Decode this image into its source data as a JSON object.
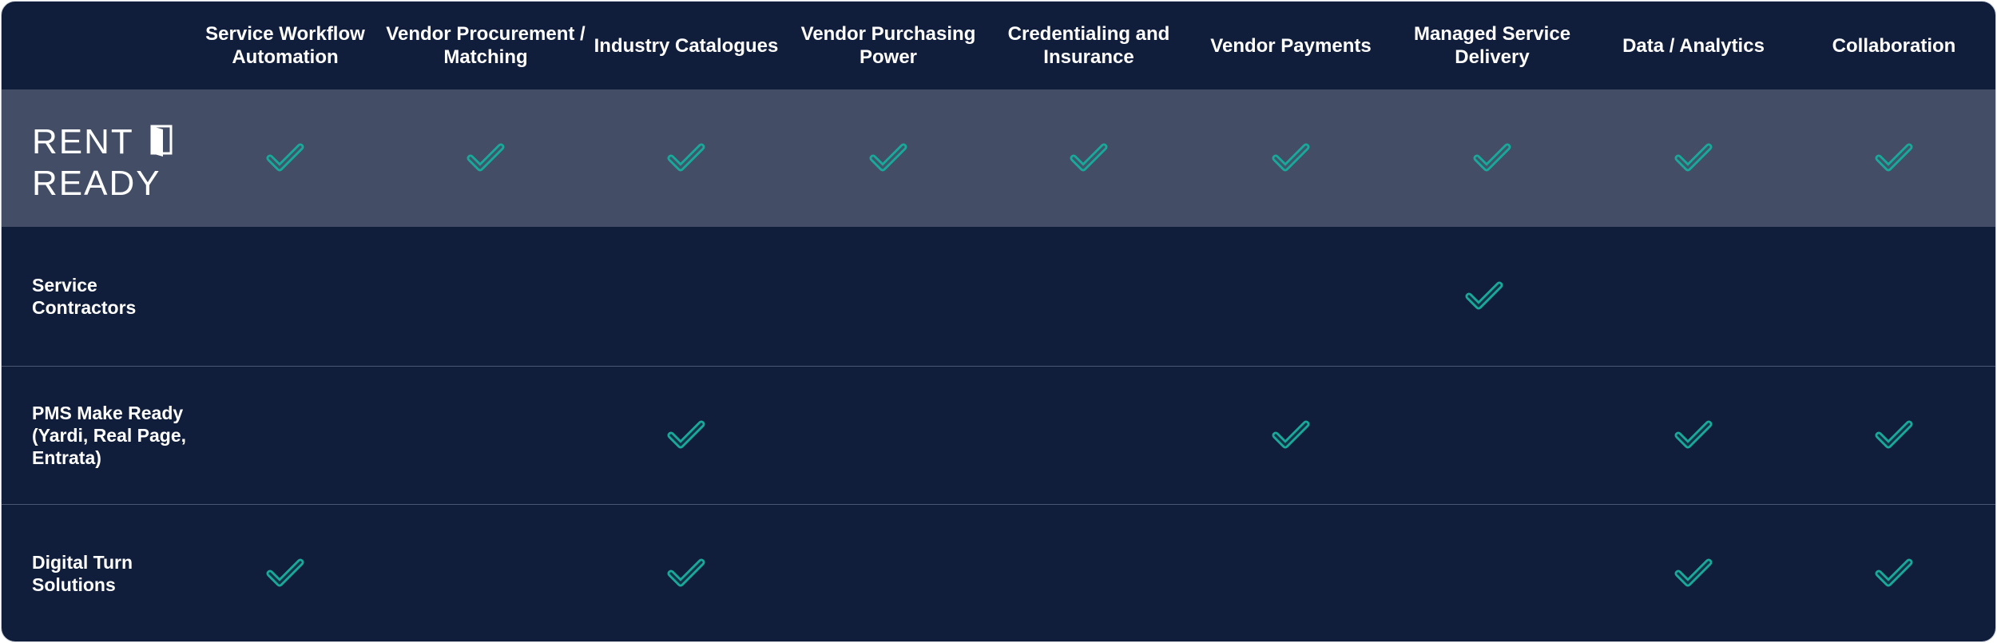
{
  "columns": [
    "Service Workflow Automation",
    "Vendor Procurement / Matching",
    "Industry Catalogues",
    "Vendor Purchasing Power",
    "Credentialing and Insurance",
    "Vendor Payments",
    "Managed Service Delivery",
    "Data / Analytics",
    "Collaboration"
  ],
  "rows": [
    {
      "label": "RENT READY",
      "is_logo": true,
      "highlight": true,
      "checks": [
        true,
        true,
        true,
        true,
        true,
        true,
        true,
        true,
        true
      ]
    },
    {
      "label": "Service Contractors",
      "is_logo": false,
      "highlight": false,
      "checks": [
        false,
        false,
        false,
        false,
        false,
        false,
        true,
        false,
        false
      ]
    },
    {
      "label": "PMS Make Ready (Yardi, Real Page, Entrata)",
      "is_logo": false,
      "highlight": false,
      "checks": [
        false,
        false,
        true,
        false,
        false,
        true,
        false,
        true,
        true
      ]
    },
    {
      "label": "Digital Turn Solutions",
      "is_logo": false,
      "highlight": false,
      "checks": [
        true,
        false,
        true,
        false,
        false,
        false,
        false,
        true,
        true
      ]
    }
  ],
  "colors": {
    "background": "#111e3b",
    "highlight_row": "#434e66",
    "check": "#19a99a",
    "text": "#ffffff",
    "divider": "#4a5672"
  },
  "icons": {
    "check": "check-icon",
    "door": "door-icon"
  }
}
